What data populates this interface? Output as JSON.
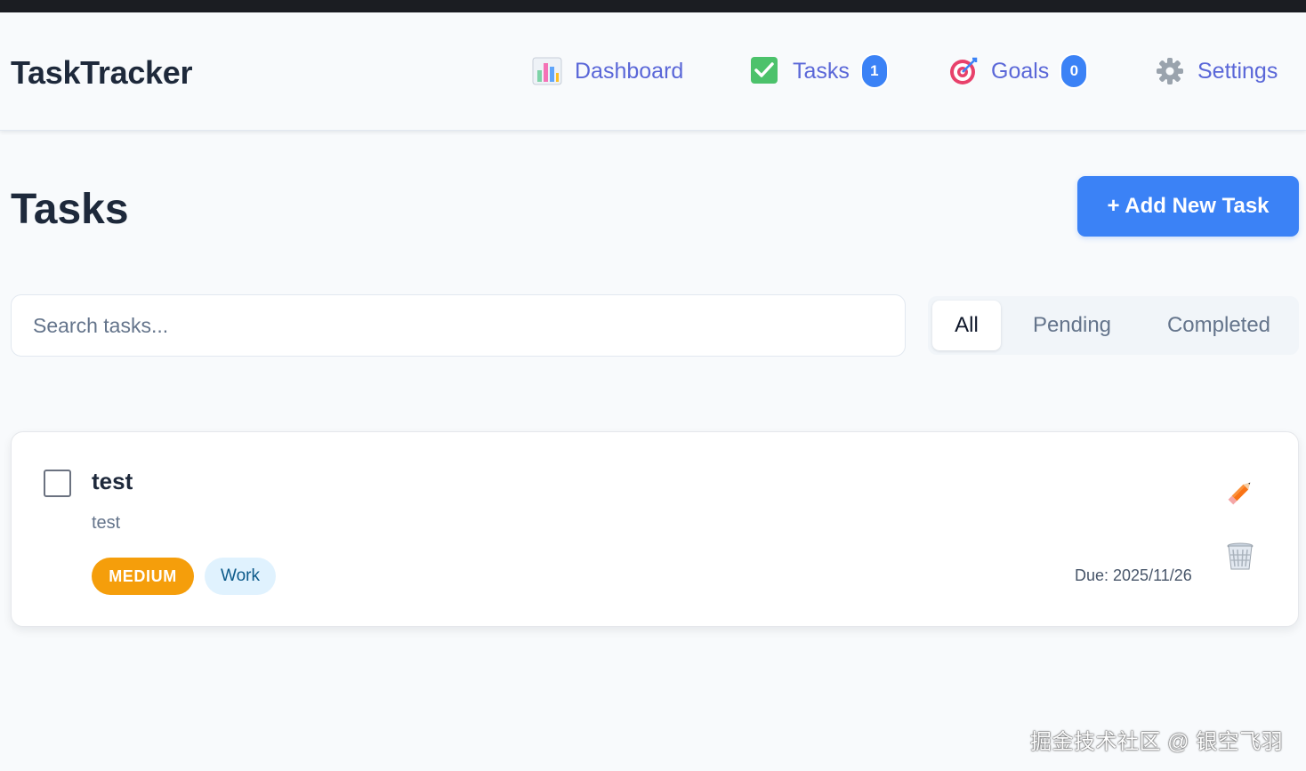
{
  "app": {
    "name": "TaskTracker"
  },
  "nav": {
    "dashboard": {
      "label": "Dashboard",
      "icon": "bar-chart-icon"
    },
    "tasks": {
      "label": "Tasks",
      "icon": "check-mark-icon",
      "count": "1"
    },
    "goals": {
      "label": "Goals",
      "icon": "target-icon",
      "count": "0"
    },
    "settings": {
      "label": "Settings",
      "icon": "gear-icon"
    }
  },
  "page": {
    "title": "Tasks",
    "add_label": "+ Add New Task"
  },
  "search": {
    "placeholder": "Search tasks...",
    "value": ""
  },
  "filters": {
    "tabs": [
      "All",
      "Pending",
      "Completed"
    ],
    "active": "All"
  },
  "tasks": [
    {
      "title": "test",
      "description": "test",
      "priority": "MEDIUM",
      "category": "Work",
      "due": "Due: 2025/11/26",
      "completed": false
    }
  ],
  "watermark": "掘金技术社区 @ 银空飞羽",
  "colors": {
    "accent": "#3b82f6",
    "nav_text": "#5a67d8",
    "priority_medium": "#f59e0b",
    "category_bg": "#e0f2fe"
  }
}
